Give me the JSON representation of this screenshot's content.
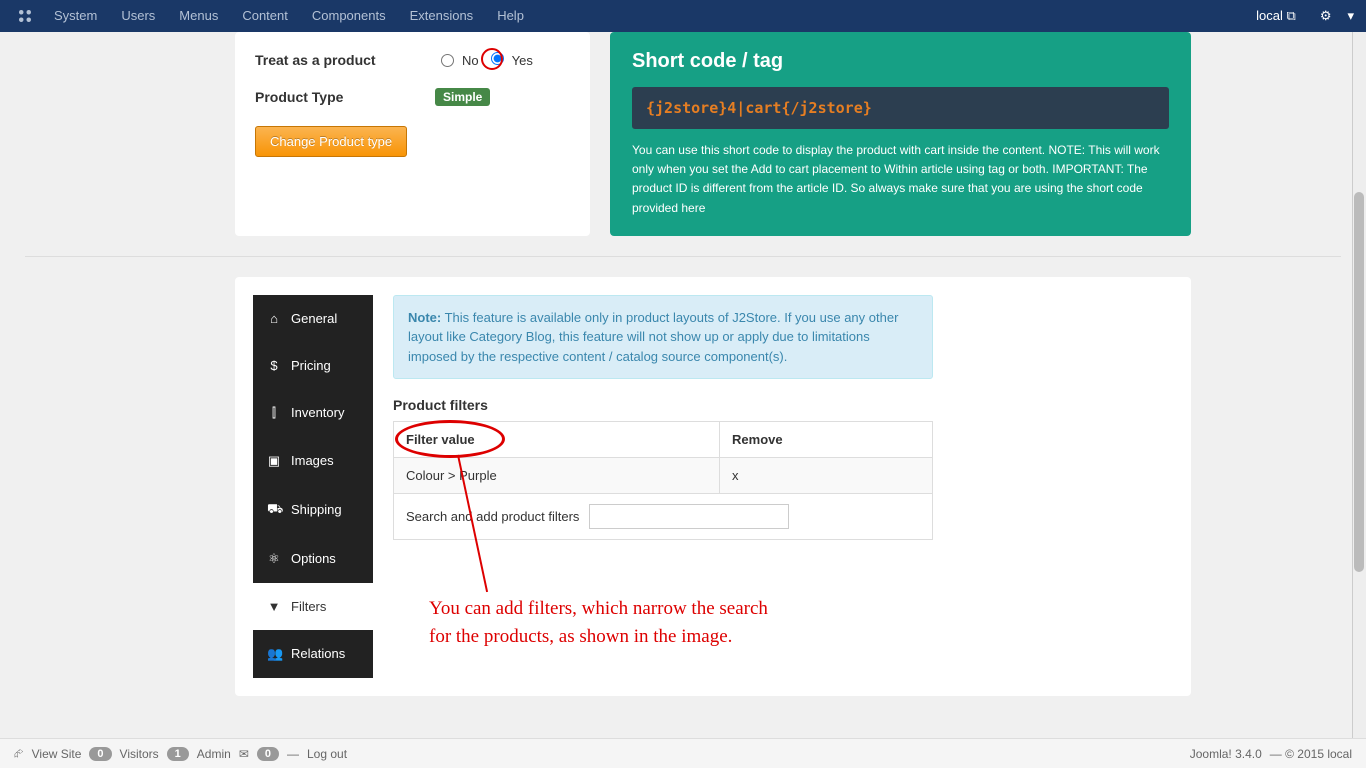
{
  "navbar": {
    "items": [
      "System",
      "Users",
      "Menus",
      "Content",
      "Components",
      "Extensions",
      "Help"
    ],
    "site_label": "local"
  },
  "product_panel": {
    "treat_label": "Treat as a product",
    "no_label": "No",
    "yes_label": "Yes",
    "type_label": "Product Type",
    "type_value": "Simple",
    "change_btn": "Change Product type"
  },
  "shortcode_panel": {
    "title": "Short code / tag",
    "code": "{j2store}4|cart{/j2store}",
    "desc": "You can use this short code to display the product with cart inside the content. NOTE: This will work only when you set the Add to cart placement to Within article using tag or both. IMPORTANT: The product ID is different from the article ID. So always make sure that you are using the short code provided here"
  },
  "tabs": [
    {
      "icon": "home",
      "label": "General"
    },
    {
      "icon": "dollar",
      "label": "Pricing"
    },
    {
      "icon": "bars",
      "label": "Inventory"
    },
    {
      "icon": "image",
      "label": "Images"
    },
    {
      "icon": "truck",
      "label": "Shipping"
    },
    {
      "icon": "nodes",
      "label": "Options"
    },
    {
      "icon": "filter",
      "label": "Filters"
    },
    {
      "icon": "users",
      "label": "Relations"
    }
  ],
  "active_tab_index": 6,
  "note": {
    "prefix": "Note:",
    "text": " This feature is available only in product layouts of J2Store. If you use any other layout like Category Blog, this feature will not show up or apply due to limitations imposed by the respective content / catalog source component(s)."
  },
  "filters": {
    "title": "Product filters",
    "col1": "Filter value",
    "col2": "Remove",
    "rows": [
      {
        "value": "Colour > Purple",
        "remove": "x"
      }
    ],
    "search_label": "Search and add product filters"
  },
  "annotation": {
    "line1": "You can add filters, which narrow the search",
    "line2": "for the products, as shown in the image."
  },
  "statusbar": {
    "view_site": "View Site",
    "visitors_count": "0",
    "visitors": "Visitors",
    "admin_count": "1",
    "admin": "Admin",
    "msg_count": "0",
    "logout": "Log out",
    "version": "Joomla! 3.4.0",
    "copyright": "— © 2015 local"
  }
}
